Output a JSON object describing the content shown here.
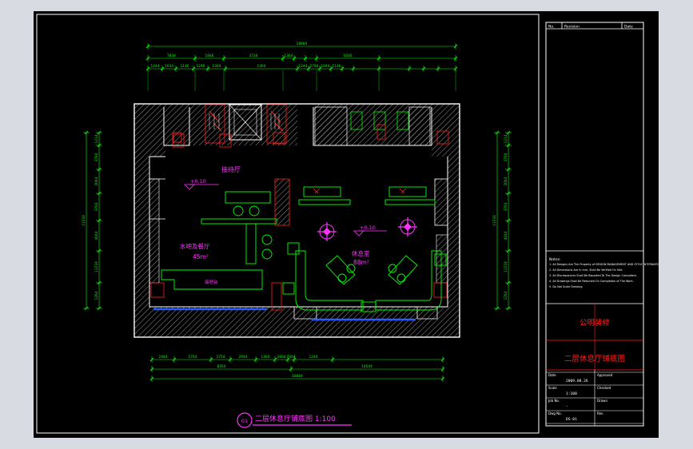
{
  "drawing": {
    "title": "二层休息厅铺底图 1:100",
    "badge": "01",
    "rooms": {
      "reception": "接待厅",
      "reception_level": "+0.10",
      "bar": "水吧及餐厅",
      "bar_area": "45m²",
      "lounge": "休息室",
      "lounge_area": "88m²",
      "lounge_level": "+0.10",
      "counter": "接吧台"
    },
    "dimensions": {
      "top_total": "18884",
      "top_row1": [
        "7834",
        "1846",
        "3734",
        "1364",
        "",
        "",
        "5600",
        ""
      ],
      "top_row2": [
        "1244",
        "1034",
        "1146",
        "1246",
        "1364",
        "1364",
        "1244",
        "2784",
        "1044",
        "1146"
      ],
      "bottom_row1": [
        "2484",
        "2744",
        "1754",
        "2944",
        "1364",
        "2804",
        "7944",
        "1244"
      ],
      "bottom_row2": [
        "8354",
        "14544"
      ],
      "bottom_total": "18884",
      "left": [
        "1214",
        "3784",
        "2044",
        "3784",
        "4044",
        "11234",
        "1264"
      ],
      "right": [
        "1214",
        "3784",
        "2044",
        "3784",
        "4044",
        "11234",
        "1264"
      ]
    }
  },
  "titleblock": {
    "header_cells": [
      "No.",
      "Revision",
      "Date"
    ],
    "notes_title": "Notes:",
    "notes": [
      "All Designs Are The Property of DESIGN MANAGEMENT AND STYLE INTERNATIONAL and Can Not Be Used Without Permission.",
      "All Dimensions Are In mm, Shall Be Verified On Site.",
      "All Discrepancies Shall Be Reported To The Design Consultant.",
      "All Drawings Shall Be Returned On Completion of The Work.",
      "Do Not Scale Drawing."
    ],
    "company": "公明装修",
    "sheet_title": "二层休息厅铺底图",
    "fields": [
      {
        "label": "Date",
        "value": "2009.08.26"
      },
      {
        "label": "Approved",
        "value": ""
      },
      {
        "label": "Scale",
        "value": "1:100"
      },
      {
        "label": "Checked",
        "value": ""
      },
      {
        "label": "Job No.",
        "value": "-"
      },
      {
        "label": "Drawn",
        "value": ""
      },
      {
        "label": "Dwg No.",
        "value": "DS-01"
      },
      {
        "label": "Rev.",
        "value": ""
      }
    ]
  },
  "colors": {
    "background": "#000000",
    "wall": "#ffffff",
    "dimension": "#00ff00",
    "text": "#ff33ff",
    "furniture": "#00ff00",
    "window": "#2b5cff",
    "accent_red": "#ff2020",
    "titleblock_line": "#ff2020",
    "frame": "#ffffff"
  }
}
